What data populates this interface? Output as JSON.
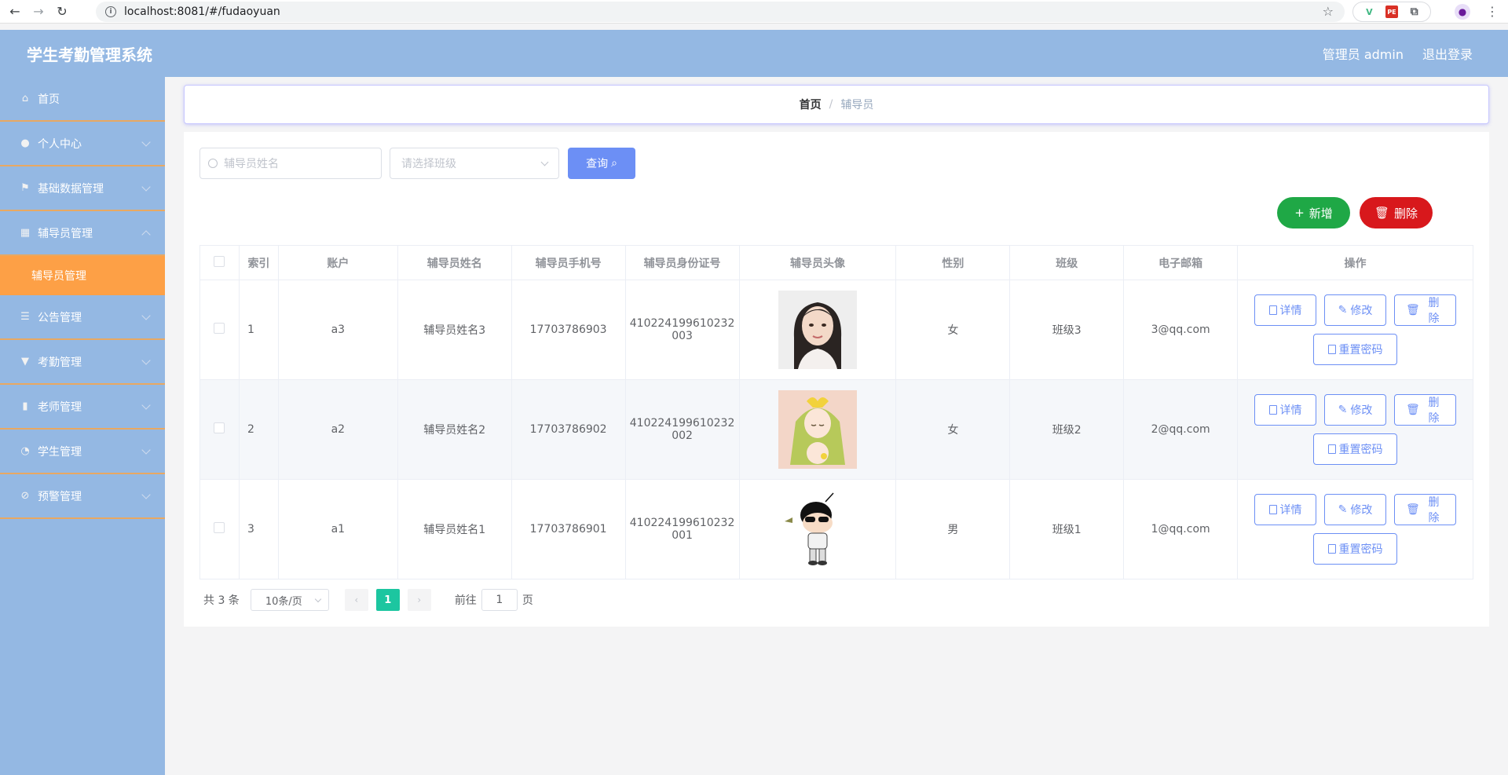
{
  "browser": {
    "url": "localhost:8081/#/fudaoyuan"
  },
  "header": {
    "title": "学生考勤管理系统",
    "user": "管理员 admin",
    "logout": "退出登录"
  },
  "sidebar": {
    "items": [
      {
        "label": "首页",
        "icon": "home-icon"
      },
      {
        "label": "个人中心",
        "icon": "user-icon"
      },
      {
        "label": "基础数据管理",
        "icon": "flag-icon"
      },
      {
        "label": "辅导员管理",
        "icon": "chart-icon"
      },
      {
        "label": "辅导员管理",
        "icon": "",
        "sub": true
      },
      {
        "label": "公告管理",
        "icon": "list-icon"
      },
      {
        "label": "考勤管理",
        "icon": "pin-icon"
      },
      {
        "label": "老师管理",
        "icon": "bar-chart-icon"
      },
      {
        "label": "学生管理",
        "icon": "gauge-icon"
      },
      {
        "label": "预警管理",
        "icon": "alert-icon"
      }
    ]
  },
  "breadcrumb": {
    "home": "首页",
    "separator": "/",
    "current": "辅导员"
  },
  "search": {
    "name_placeholder": "辅导员姓名",
    "class_placeholder": "请选择班级",
    "query_label": "查询"
  },
  "actions": {
    "add_label": "新增",
    "delete_label": "删除"
  },
  "table": {
    "columns": [
      "索引",
      "账户",
      "辅导员姓名",
      "辅导员手机号",
      "辅导员身份证号",
      "辅导员头像",
      "性别",
      "班级",
      "电子邮箱",
      "操作"
    ],
    "rows": [
      {
        "index": "1",
        "account": "a3",
        "name": "辅导员姓名3",
        "phone": "17703786903",
        "id_line1": "410224199610232",
        "id_line2": "003",
        "gender": "女",
        "class": "班级3",
        "email": "3@qq.com"
      },
      {
        "index": "2",
        "account": "a2",
        "name": "辅导员姓名2",
        "phone": "17703786902",
        "id_line1": "410224199610232",
        "id_line2": "002",
        "gender": "女",
        "class": "班级2",
        "email": "2@qq.com"
      },
      {
        "index": "3",
        "account": "a1",
        "name": "辅导员姓名1",
        "phone": "17703786901",
        "id_line1": "410224199610232",
        "id_line2": "001",
        "gender": "男",
        "class": "班级1",
        "email": "1@qq.com"
      }
    ],
    "op_labels": {
      "detail": "详情",
      "edit": "修改",
      "delete": "删除",
      "reset": "重置密码"
    }
  },
  "pagination": {
    "total": "共 3 条",
    "page_size": "10条/页",
    "current_page": "1",
    "goto_label": "前往",
    "goto_value": "1",
    "goto_suffix": "页"
  },
  "colors": {
    "header_bg": "#94b8e3",
    "sidebar_active": "#fda046",
    "primary": "#6c8ff5",
    "success": "#1fa846",
    "danger": "#d8181c",
    "page_current": "#1cc6a0"
  }
}
